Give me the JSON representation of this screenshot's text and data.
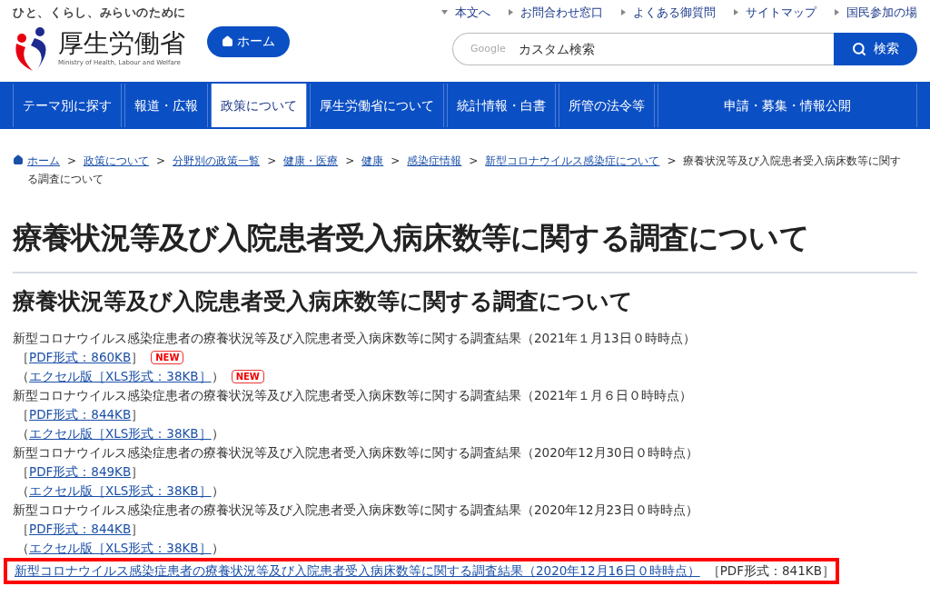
{
  "header": {
    "tagline": "ひと、くらし、みらいのために",
    "logo_text": "厚生労働省",
    "logo_subtext": "Ministry of Health, Labour and Welfare",
    "home_button": "ホーム",
    "utility_links": [
      {
        "label": "本文へ",
        "kind": "down"
      },
      {
        "label": "お問合わせ窓口",
        "kind": "right"
      },
      {
        "label": "よくある御質問",
        "kind": "right"
      },
      {
        "label": "サイトマップ",
        "kind": "right"
      },
      {
        "label": "国民参加の場",
        "kind": "right"
      }
    ],
    "search": {
      "brand": "Google",
      "placeholder": "カスタム検索",
      "button": "検索"
    }
  },
  "nav": [
    {
      "label": "テーマ別に探す",
      "selected": false
    },
    {
      "label": "報道・広報",
      "selected": false
    },
    {
      "label": "政策について",
      "selected": true
    },
    {
      "label": "厚生労働省について",
      "selected": false
    },
    {
      "label": "統計情報・白書",
      "selected": false
    },
    {
      "label": "所管の法令等",
      "selected": false
    },
    {
      "label": "申請・募集・情報公開",
      "selected": false
    }
  ],
  "breadcrumb": {
    "links": [
      {
        "label": "ホーム",
        "separator": ">"
      },
      {
        "label": "政策について",
        "separator": ">"
      },
      {
        "label": "分野別の政策一覧",
        "separator": ">"
      },
      {
        "label": "健康・医療",
        "separator": ">"
      },
      {
        "label": "健康",
        "separator": ">"
      },
      {
        "label": "感染症情報",
        "separator": ">"
      },
      {
        "label": "新型コロナウイルス感染症について",
        "separator": ">"
      }
    ],
    "current": "療養状況等及び入院患者受入病床数等に関する調査について"
  },
  "page_title": "療養状況等及び入院患者受入病床数等に関する調査について",
  "section_title": "療養状況等及び入院患者受入病床数等に関する調査について",
  "items": [
    {
      "kind": "standard",
      "title": "新型コロナウイルス感染症患者の療養状況等及び入院患者受入病床数等に関する調査結果（2021年１月13日０時時点）",
      "pdf_open": "［",
      "pdf": "PDF形式：860KB",
      "pdf_close": "］",
      "pdf_badge": "NEW",
      "xls_open": "（",
      "xls": "エクセル版［XLS形式：38KB］",
      "xls_close": "）",
      "xls_badge": "NEW"
    },
    {
      "kind": "standard",
      "title": "新型コロナウイルス感染症患者の療養状況等及び入院患者受入病床数等に関する調査結果（2021年１月６日０時時点）",
      "pdf_open": "［",
      "pdf": "PDF形式：844KB",
      "pdf_close": "］",
      "xls_open": "（",
      "xls": "エクセル版［XLS形式：38KB］",
      "xls_close": "）"
    },
    {
      "kind": "standard",
      "title": "新型コロナウイルス感染症患者の療養状況等及び入院患者受入病床数等に関する調査結果（2020年12月30日０時時点）",
      "pdf_open": "［",
      "pdf": "PDF形式：849KB",
      "pdf_close": "］",
      "xls_open": "（",
      "xls": "エクセル版［XLS形式：38KB］",
      "xls_close": "）"
    },
    {
      "kind": "standard",
      "title": "新型コロナウイルス感染症患者の療養状況等及び入院患者受入病床数等に関する調査結果（2020年12月23日０時時点）",
      "pdf_open": "［",
      "pdf": "PDF形式：844KB",
      "pdf_close": "］",
      "xls_open": "（",
      "xls": "エクセル版［XLS形式：38KB］",
      "xls_close": "）"
    },
    {
      "kind": "highlighted",
      "title": "新型コロナウイルス感染症患者の療養状況等及び入院患者受入病床数等に関する調査結果（2020年12月16日０時時点）",
      "pdf": "［PDF形式：841KB］"
    }
  ]
}
